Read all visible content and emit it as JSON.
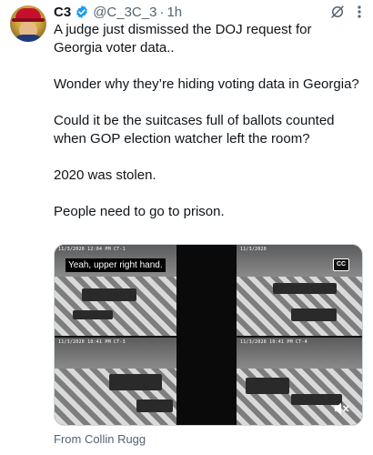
{
  "author": {
    "name": "C3",
    "handle": "@C_3C_3",
    "separator": "·",
    "time": "1h"
  },
  "tweet": {
    "paragraphs": [
      "A judge just dismissed the DOJ request for Georgia voter data..",
      "Wonder why they’re hiding voting data in Georgia?",
      "Could it be the suitcases full of ballots counted when GOP election watcher left the room?",
      "2020 was stolen.",
      "People need to go to prison."
    ]
  },
  "media": {
    "caption": "Yeah, upper right hand.",
    "cc_label": "CC",
    "cam_stamps": [
      "11/3/2020 12:04 PM CT-1",
      "11/3/2020",
      "11/3/2020 10:41 PM CT-3",
      "11/3/2020 10:41 PM CT-4"
    ]
  },
  "attribution": "From Collin Rugg",
  "icons": {
    "verified": "verified-badge-icon",
    "grok": "grok-icon",
    "more": "more-options-icon",
    "mute": "mute-icon"
  },
  "colors": {
    "verified": "#1d9bf0",
    "secondary_text": "#536471",
    "primary_text": "#0f1419"
  }
}
